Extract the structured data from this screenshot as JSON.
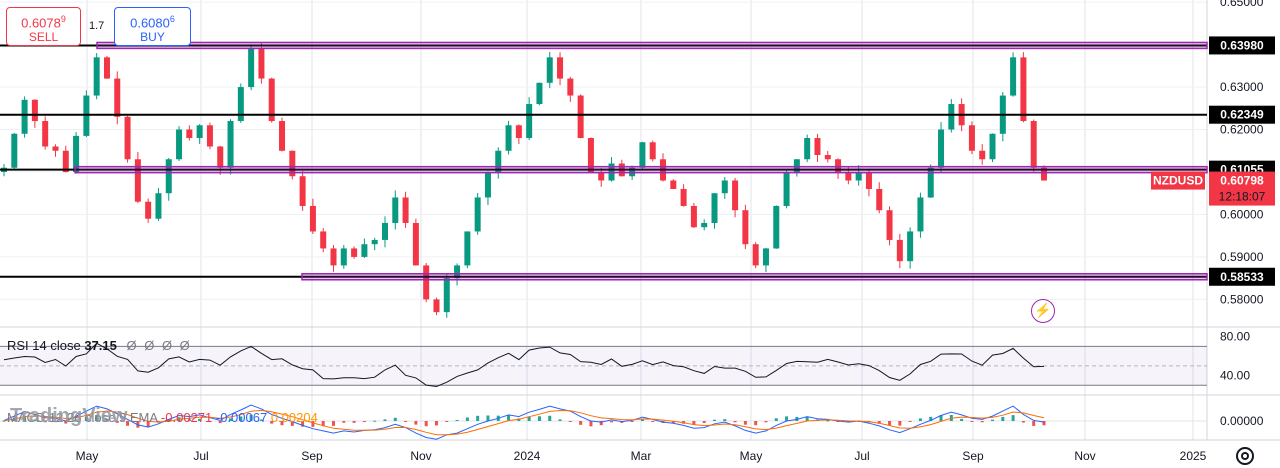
{
  "symbol": "NZDUSD",
  "trade": {
    "sell": {
      "price_main": "0.6078",
      "price_pip": "9",
      "label": "SELL"
    },
    "spread": "1.7",
    "buy": {
      "price_main": "0.6080",
      "price_pip": "6",
      "label": "BUY"
    }
  },
  "price_axis": {
    "ticks": [
      "0.65000",
      "0.63000",
      "0.62000",
      "0.61000",
      "0.60000",
      "0.59000",
      "0.58000"
    ],
    "levels": [
      {
        "label": "0.63980",
        "value": 0.6398
      },
      {
        "label": "0.62349",
        "value": 0.62349
      },
      {
        "label": "0.61055",
        "value": 0.61055
      },
      {
        "label": "0.58533",
        "value": 0.58533
      }
    ],
    "current": {
      "label": "0.60798",
      "value": 0.60798,
      "countdown": "12:18:07"
    }
  },
  "time_axis": [
    "May",
    "Jul",
    "Sep",
    "Nov",
    "2024",
    "Mar",
    "May",
    "Jul",
    "Sep",
    "Nov",
    "2025"
  ],
  "rsi": {
    "title": "RSI 14 close",
    "value": "37.15",
    "ticks": [
      "80.00",
      "40.00"
    ],
    "eye_icons": "Ø Ø Ø Ø",
    "upper_band": 70,
    "lower_band": 30,
    "middle_band": 50
  },
  "macd": {
    "title": "MACD 12 26 close 9 EMA",
    "values": [
      "-0.00271",
      "-0.00067",
      "0.00204"
    ],
    "tick": "0.00000"
  },
  "watermark": "TradingView",
  "colors": {
    "up": "#089981",
    "down": "#f23645",
    "zone": "#9c27b0",
    "level": "#000000",
    "rsi_line": "#131722",
    "macd_line": "#2962ff",
    "signal_line": "#ff6d00"
  },
  "icons": {
    "flash": "flash-icon",
    "settings": "settings-icon"
  },
  "chart_data": {
    "type": "candlestick",
    "instrument": "NZDUSD",
    "timeframe": "daily",
    "price_range": [
      0.5735,
      0.6505
    ],
    "series": [
      {
        "name": "NZDUSD",
        "values": [
          0.611,
          0.619,
          0.627,
          0.622,
          0.616,
          0.615,
          0.61,
          0.6185,
          0.628,
          0.637,
          0.632,
          0.623,
          0.613,
          0.603,
          0.599,
          0.605,
          0.613,
          0.62,
          0.618,
          0.621,
          0.616,
          0.611,
          0.622,
          0.63,
          0.639,
          0.632,
          0.622,
          0.615,
          0.609,
          0.602,
          0.596,
          0.592,
          0.588,
          0.592,
          0.59,
          0.593,
          0.594,
          0.598,
          0.604,
          0.598,
          0.588,
          0.58,
          0.577,
          0.585,
          0.588,
          0.596,
          0.604,
          0.61,
          0.615,
          0.621,
          0.618,
          0.626,
          0.631,
          0.637,
          0.632,
          0.628,
          0.618,
          0.61,
          0.608,
          0.612,
          0.609,
          0.611,
          0.617,
          0.613,
          0.608,
          0.606,
          0.602,
          0.597,
          0.598,
          0.605,
          0.608,
          0.601,
          0.593,
          0.588,
          0.592,
          0.602,
          0.61,
          0.613,
          0.618,
          0.614,
          0.613,
          0.61,
          0.608,
          0.61,
          0.606,
          0.601,
          0.594,
          0.589,
          0.596,
          0.604,
          0.611,
          0.62,
          0.626,
          0.621,
          0.615,
          0.613,
          0.619,
          0.628,
          0.637,
          0.622,
          0.611,
          0.608
        ]
      }
    ],
    "horizontal_levels": [
      0.6398,
      0.62349,
      0.61055,
      0.58533
    ],
    "last_price": 0.60798
  }
}
